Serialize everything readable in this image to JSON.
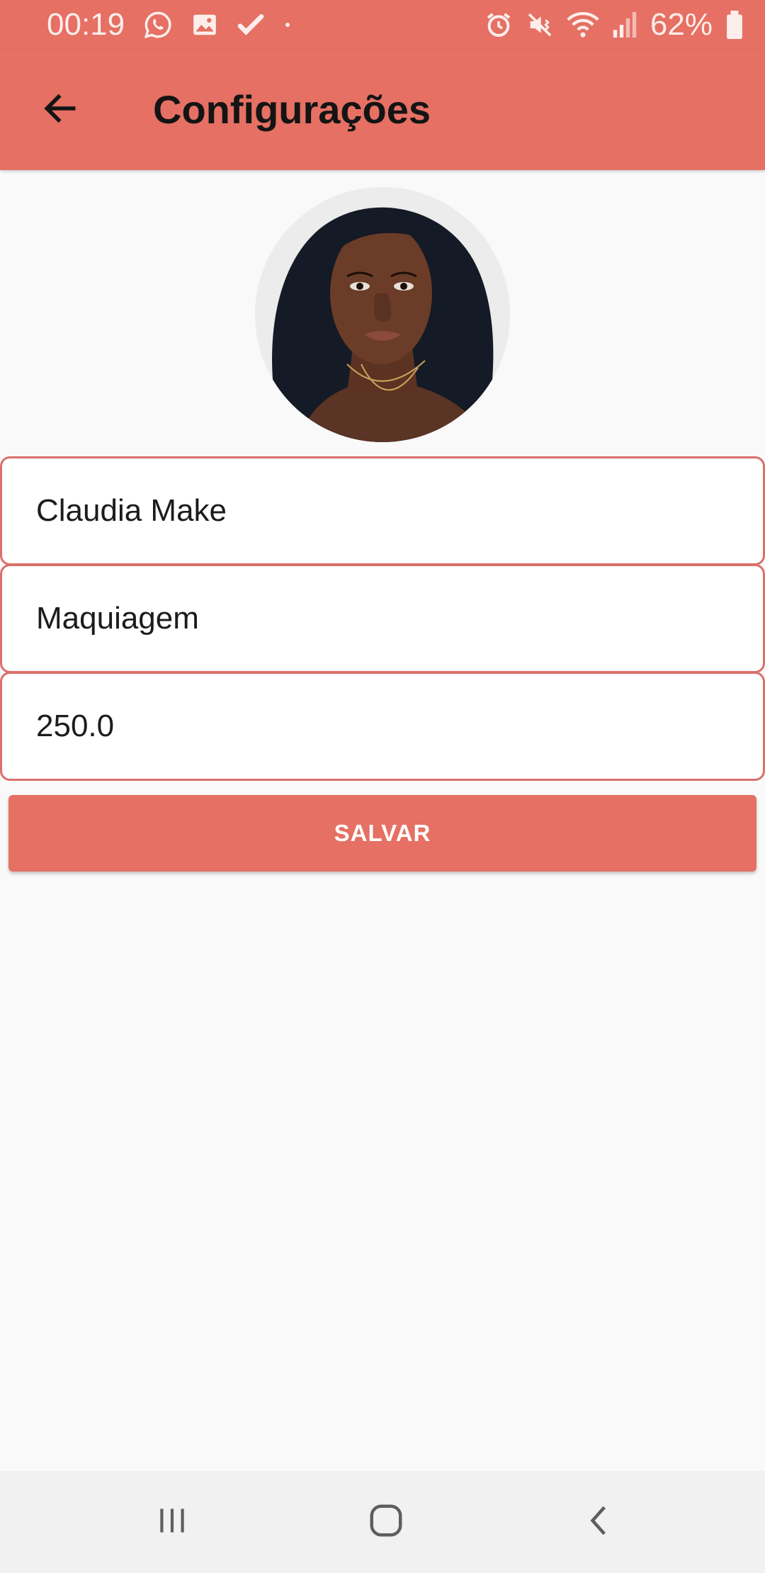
{
  "status_bar": {
    "time": "00:19",
    "battery": "62%",
    "left_icons": [
      "whatsapp-icon",
      "gallery-icon",
      "check-icon",
      "dot-icon"
    ],
    "right_icons": [
      "alarm-icon",
      "mute-vibrate-icon",
      "wifi-icon",
      "signal-icon",
      "battery-icon"
    ]
  },
  "app_bar": {
    "title": "Configurações",
    "back_icon": "arrow-back-icon"
  },
  "profile": {
    "avatar": "profile-photo"
  },
  "form": {
    "name_value": "Claudia Make",
    "category_value": "Maquiagem",
    "price_value": "250.0",
    "save_label": "SALVAR"
  },
  "nav_bar": {
    "icons": [
      "recent-apps-icon",
      "home-icon",
      "back-icon"
    ]
  },
  "colors": {
    "primary": "#e57063",
    "field_border": "#d9706a",
    "background": "#f9f9f9",
    "nav_background": "#f1f1f1"
  }
}
